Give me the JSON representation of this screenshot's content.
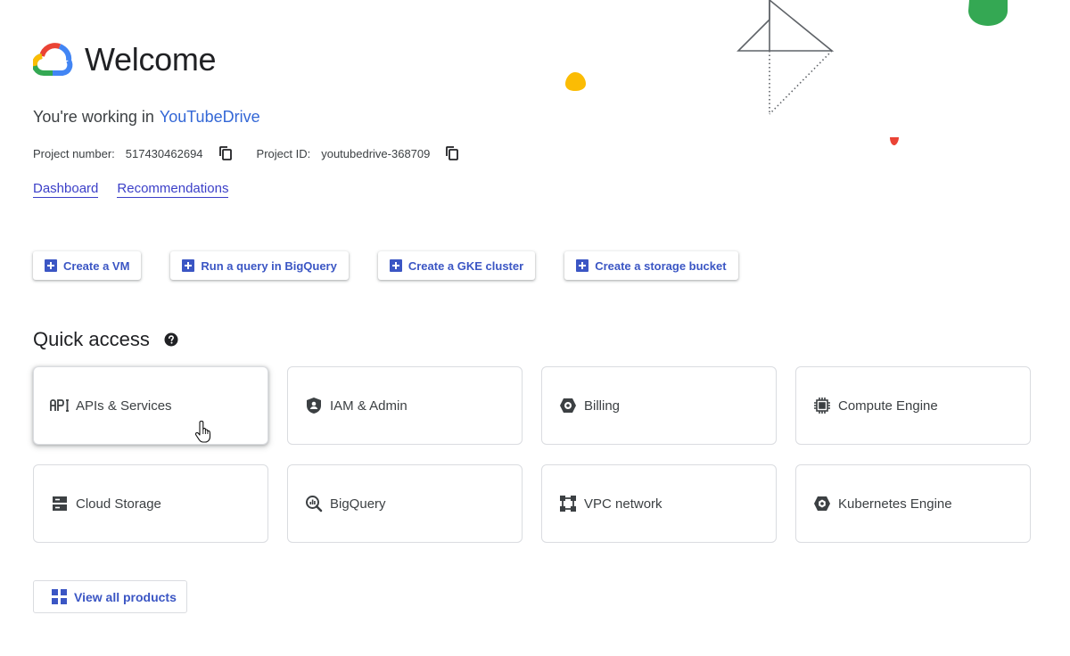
{
  "header": {
    "title": "Welcome"
  },
  "project": {
    "working_prefix": "You're working in",
    "name": "YouTubeDrive",
    "number_label": "Project number:",
    "number": "517430462694",
    "id_label": "Project ID:",
    "id": "youtubedrive-368709"
  },
  "links": {
    "dashboard": "Dashboard",
    "recommendations": "Recommendations"
  },
  "actions": {
    "create_vm": "Create a VM",
    "run_query": "Run a query in BigQuery",
    "create_gke": "Create a GKE cluster",
    "create_bucket": "Create a storage bucket"
  },
  "quick_access": {
    "title": "Quick access",
    "items": [
      {
        "label": "APIs & Services",
        "icon": "api-icon"
      },
      {
        "label": "IAM & Admin",
        "icon": "shield-icon"
      },
      {
        "label": "Billing",
        "icon": "billing-icon"
      },
      {
        "label": "Compute Engine",
        "icon": "chip-icon"
      },
      {
        "label": "Cloud Storage",
        "icon": "storage-icon"
      },
      {
        "label": "BigQuery",
        "icon": "bigquery-icon"
      },
      {
        "label": "VPC network",
        "icon": "vpc-network-icon"
      },
      {
        "label": "Kubernetes Engine",
        "icon": "kubernetes-icon"
      }
    ]
  },
  "view_all": "View all products",
  "colors": {
    "link": "#3b3fc8",
    "action_text": "#3b56c4",
    "google_blue": "#4285f4",
    "google_red": "#ea4335",
    "google_yellow": "#fbbc04",
    "google_green": "#34a853"
  }
}
